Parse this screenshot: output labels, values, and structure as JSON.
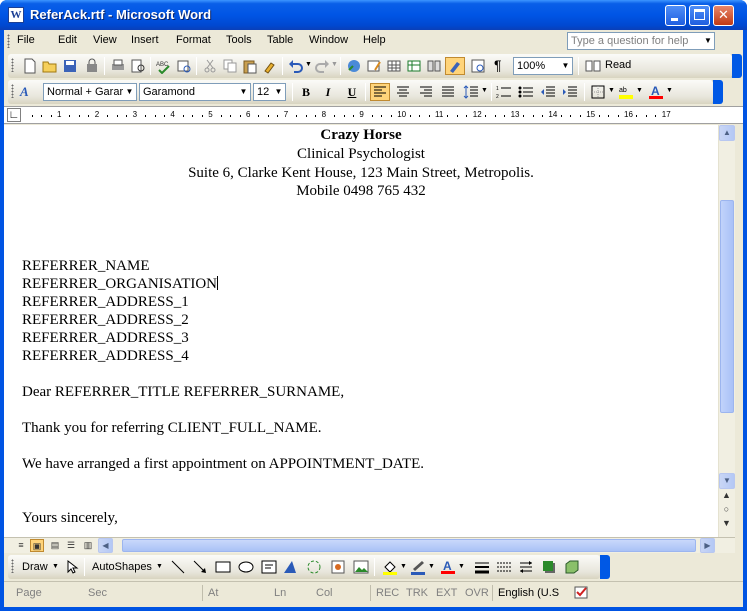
{
  "window": {
    "title": "ReferAck.rtf - Microsoft Word"
  },
  "menu": {
    "items": [
      "File",
      "Edit",
      "View",
      "Insert",
      "Format",
      "Tools",
      "Table",
      "Window",
      "Help"
    ],
    "help_placeholder": "Type a question for help"
  },
  "standard_toolbar": {
    "zoom": "100%",
    "read_label": "Read"
  },
  "formatting_toolbar": {
    "style": "Normal + Garar",
    "font": "Garamond",
    "size": "12",
    "bold": "B",
    "italic": "I",
    "underline": "U",
    "alignment": "left"
  },
  "ruler": {
    "numbers": [
      "1",
      "2",
      "3",
      "4",
      "5",
      "6",
      "7",
      "8",
      "9",
      "10",
      "11",
      "12",
      "13",
      "14",
      "15",
      "16",
      "17"
    ]
  },
  "document": {
    "header_name": "Crazy Horse",
    "header_title": "Clinical Psychologist",
    "header_address": "Suite 6, Clarke Kent House, 123 Main Street, Metropolis.",
    "header_mobile": "Mobile 0498 765 432",
    "referrer_lines": [
      "REFERRER_NAME",
      "REFERRER_ORGANISATION",
      "REFERRER_ADDRESS_1",
      "REFERRER_ADDRESS_2",
      "REFERRER_ADDRESS_3",
      "REFERRER_ADDRESS_4"
    ],
    "salutation": "Dear REFERRER_TITLE REFERRER_SURNAME,",
    "body_1": "Thank you for referring CLIENT_FULL_NAME.",
    "body_2": "We have arranged a first appointment on APPOINTMENT_DATE.",
    "closing": "Yours sincerely,"
  },
  "draw_toolbar": {
    "draw_label": "Draw",
    "autoshapes_label": "AutoShapes"
  },
  "status_bar": {
    "page": "Page",
    "sec": "Sec",
    "at": "At",
    "ln": "Ln",
    "col": "Col",
    "rec": "REC",
    "trk": "TRK",
    "ext": "EXT",
    "ovr": "OVR",
    "language": "English (U.S"
  },
  "colors": {
    "title_bar": "#0054e3",
    "chrome": "#ece9d8",
    "active_button": "#ffd47a"
  }
}
